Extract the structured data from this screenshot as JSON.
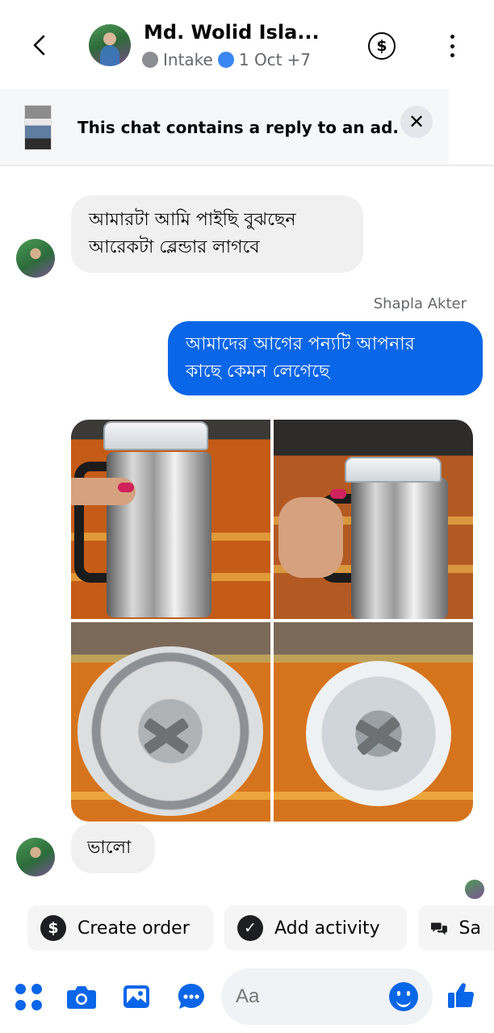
{
  "header": {
    "title": "Md. Wolid Isla...",
    "label_tag": "Intake",
    "date_tag": "1 Oct",
    "more_tags": "+7",
    "colors": {
      "label_dot": "#8a8d91",
      "date_dot": "#3a86f2"
    }
  },
  "ad_banner": {
    "text": "This chat contains a reply to an ad.",
    "close_glyph": "✕"
  },
  "messages": [
    {
      "direction": "incoming",
      "text_line1": "আমারটা আমি পাইছি বুঝছেন",
      "text_line2": "আরেকটা ব্লেন্ডার লাগবে"
    },
    {
      "direction": "outgoing",
      "sender_name": "Shapla Akter",
      "text_line1": "আমাদের আগের পন্যটি আপনার",
      "text_line2": "কাছে কেমন লেগেছে"
    },
    {
      "direction": "outgoing",
      "type": "photo-grid",
      "photo_count": 4
    },
    {
      "direction": "incoming",
      "text": "ভালো"
    }
  ],
  "quick_actions": [
    {
      "label": "Create order",
      "icon": "dollar-icon"
    },
    {
      "label": "Add activity",
      "icon": "check-circle-icon"
    },
    {
      "label": "Sa",
      "icon": "chat-bubbles-icon"
    }
  ],
  "composer": {
    "placeholder": "Aa",
    "icons": [
      "apps-icon",
      "camera-icon",
      "gallery-icon",
      "chat-more-icon",
      "emoji-icon",
      "like-icon"
    ]
  },
  "colors": {
    "accent": "#0a66e8",
    "bubble_in": "#f0f0f0"
  }
}
